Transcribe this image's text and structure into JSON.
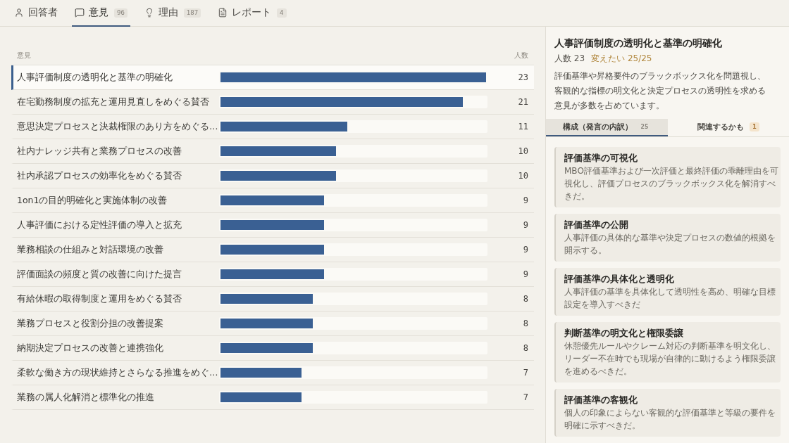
{
  "tabs": [
    {
      "label": "回答者",
      "selected": false
    },
    {
      "label": "意見",
      "count": "96",
      "selected": true
    },
    {
      "label": "理由",
      "count": "187",
      "selected": false
    },
    {
      "label": "レポート",
      "count": "4",
      "selected": false
    }
  ],
  "opinions": {
    "columns": [
      "意見",
      "人数"
    ],
    "rows": [
      {
        "label": "人事評価制度の透明化と基準の明確化",
        "count": "23",
        "level": 1,
        "selected": true
      },
      {
        "label": "在宅勤務制度の拡充と運用見直しをめぐる賛否",
        "count": "21",
        "level": 0.913,
        "selected": false
      },
      {
        "label": "意思決定プロセスと決裁権限のあり方をめぐる…",
        "count": "11",
        "level": 0.478,
        "selected": false
      },
      {
        "label": "社内ナレッジ共有と業務プロセスの改善",
        "count": "10",
        "level": 0.435,
        "selected": false
      },
      {
        "label": "社内承認プロセスの効率化をめぐる賛否",
        "count": "10",
        "level": 0.435,
        "selected": false
      },
      {
        "label": "1on1の目的明確化と実施体制の改善",
        "count": "9",
        "level": 0.391,
        "selected": false
      },
      {
        "label": "人事評価における定性評価の導入と拡充",
        "count": "9",
        "level": 0.391,
        "selected": false
      },
      {
        "label": "業務相談の仕組みと対話環境の改善",
        "count": "9",
        "level": 0.391,
        "selected": false
      },
      {
        "label": "評価面談の頻度と質の改善に向けた提言",
        "count": "9",
        "level": 0.391,
        "selected": false
      },
      {
        "label": "有給休暇の取得制度と運用をめぐる賛否",
        "count": "8",
        "level": 0.348,
        "selected": false
      },
      {
        "label": "業務プロセスと役割分担の改善提案",
        "count": "8",
        "level": 0.348,
        "selected": false
      },
      {
        "label": "納期決定プロセスの改善と連携強化",
        "count": "8",
        "level": 0.348,
        "selected": false
      },
      {
        "label": "柔軟な働き方の現状維持とさらなる推進をめぐ…",
        "count": "7",
        "level": 0.304,
        "selected": false
      },
      {
        "label": "業務の属人化解消と標準化の推進",
        "count": "7",
        "level": 0.304,
        "selected": false
      }
    ]
  },
  "detail": {
    "title": "人事評価制度の透明化と基準の明確化",
    "count_label": "人数 23",
    "change_label": "変えたい 25/25",
    "description": "評価基準や昇格要件のブラックボックス化を問題視し、客観的な指標の明文化と決定プロセスの透明性を求める意見が多数を占めています。",
    "tabs": [
      {
        "label": "構成（発言の内訳）",
        "count": "25",
        "kind": "total",
        "selected": true
      },
      {
        "label": "関連するかも",
        "count": "1",
        "kind": "suggestion",
        "selected": false
      }
    ],
    "cards": [
      {
        "title": "評価基準の可視化",
        "body": "MBO評価基準および一次評価と最終評価の乖離理由を可視化し、評価プロセスのブラックボックス化を解消すべきだ。"
      },
      {
        "title": "評価基準の公開",
        "body": "人事評価の具体的な基準や決定プロセスの数値的根拠を開示する。"
      },
      {
        "title": "評価基準の具体化と透明化",
        "body": "人事評価の基準を具体化して透明性を高め、明確な目標設定を導入すべきだ"
      },
      {
        "title": "判断基準の明文化と権限委譲",
        "body": "休憩優先ルールやクレーム対応の判断基準を明文化し、リーダー不在時でも現場が自律的に動けるよう権限委譲を進めるべきだ。"
      },
      {
        "title": "評価基準の客観化",
        "body": "個人の印象によらない客観的な評価基準と等級の要件を明確に示すべきだ。"
      }
    ]
  }
}
